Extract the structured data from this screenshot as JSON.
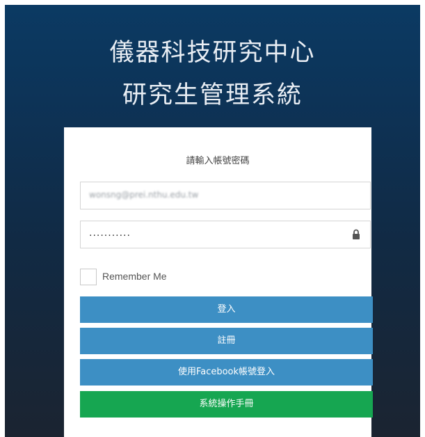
{
  "header": {
    "title_line1": "儀器科技研究中心",
    "title_line2": "研究生管理系統"
  },
  "login": {
    "prompt": "請輸入帳號密碼",
    "username_value": "wonsng@prei.nthu.edu.tw",
    "password_value": "...........",
    "lock_icon": "lock-icon",
    "remember_label": "Remember Me",
    "remember_checked": false,
    "login_button": "登入",
    "register_button": "註冊",
    "facebook_button": "使用Facebook帳號登入",
    "manual_button": "系統操作手冊"
  },
  "colors": {
    "background_top": "#0b3a63",
    "background_bottom": "#1b2431",
    "primary_button": "#3d8fc4",
    "manual_button": "#16a651"
  }
}
